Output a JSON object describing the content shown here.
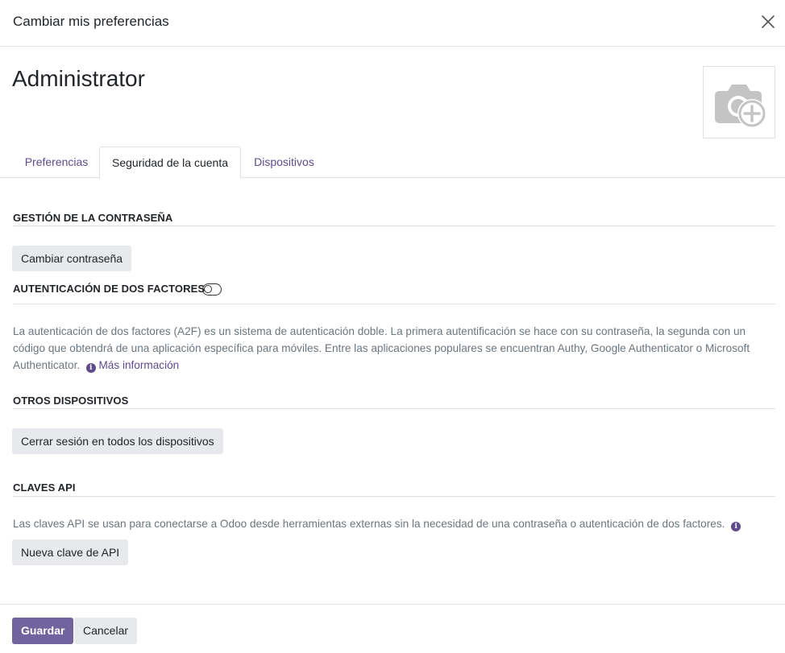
{
  "dialog": {
    "title": "Cambiar mis preferencias",
    "record_name": "Administrator"
  },
  "tabs": [
    {
      "label": "Preferencias",
      "active": false
    },
    {
      "label": "Seguridad de la cuenta",
      "active": true
    },
    {
      "label": "Dispositivos",
      "active": false
    }
  ],
  "password": {
    "section_title": "GESTIÓN DE LA CONTRASEÑA",
    "button_label": "Cambiar contraseña"
  },
  "two_factor": {
    "section_title": "AUTENTICACIÓN DE DOS FACTORES",
    "enabled": false,
    "description": "La autenticación de dos factores (A2F) es un sistema de autenticación doble. La primera autentificación se hace con su contraseña, la segunda con un código que obtendrá de una aplicación específica para móviles. Entre las aplicaciones populares se encuentran Authy, Google Authenticator o Microsoft Authenticator.",
    "more_info_label": "Más información"
  },
  "other_devices": {
    "section_title": "OTROS DISPOSITIVOS",
    "button_label": "Cerrar sesión en todos los dispositivos"
  },
  "api_keys": {
    "section_title": "CLAVES API",
    "description": "Las claves API se usan para conectarse a Odoo desde herramientas externas sin la necesidad de una contraseña o autenticación de dos factores.",
    "button_label": "Nueva clave de API"
  },
  "footer": {
    "save_label": "Guardar",
    "cancel_label": "Cancelar"
  },
  "icons": {
    "close": "close-icon",
    "avatar": "camera-plus-icon",
    "info": "info-icon",
    "info_glyph": "i"
  },
  "colors": {
    "accent": "#71639e",
    "link": "#5e4b8b",
    "muted_text": "#6c757d",
    "secondary_button": "#e7e9ed"
  }
}
